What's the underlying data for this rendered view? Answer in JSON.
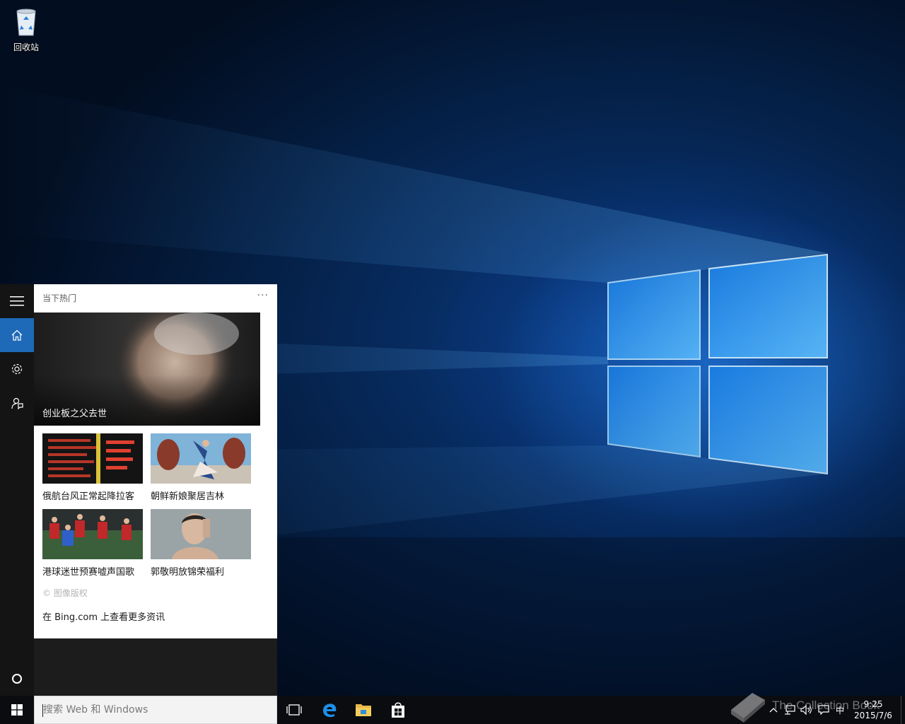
{
  "desktop": {
    "recycle_bin_label": "回收站"
  },
  "cortana": {
    "section_title": "当下热门",
    "more_label": "···",
    "hero": {
      "caption": "创业板之父去世"
    },
    "news": [
      {
        "caption": "俄航台风正常起降拉客"
      },
      {
        "caption": "朝鲜新娘聚居吉林"
      },
      {
        "caption": "港球迷世预赛嘘声国歌"
      },
      {
        "caption": "郭敬明放锦荣福利"
      }
    ],
    "copyright": "© 图像版权",
    "bing_link": "在 Bing.com 上查看更多资讯"
  },
  "taskbar": {
    "search_placeholder": "搜索 Web 和 Windows",
    "ime": "中",
    "time": "9:25",
    "date": "2015/7/6"
  },
  "watermark": {
    "text": "The Collection Book"
  },
  "colors": {
    "accent": "#1e6ab8",
    "taskbar": "#0a0c10",
    "rail": "#141414"
  }
}
